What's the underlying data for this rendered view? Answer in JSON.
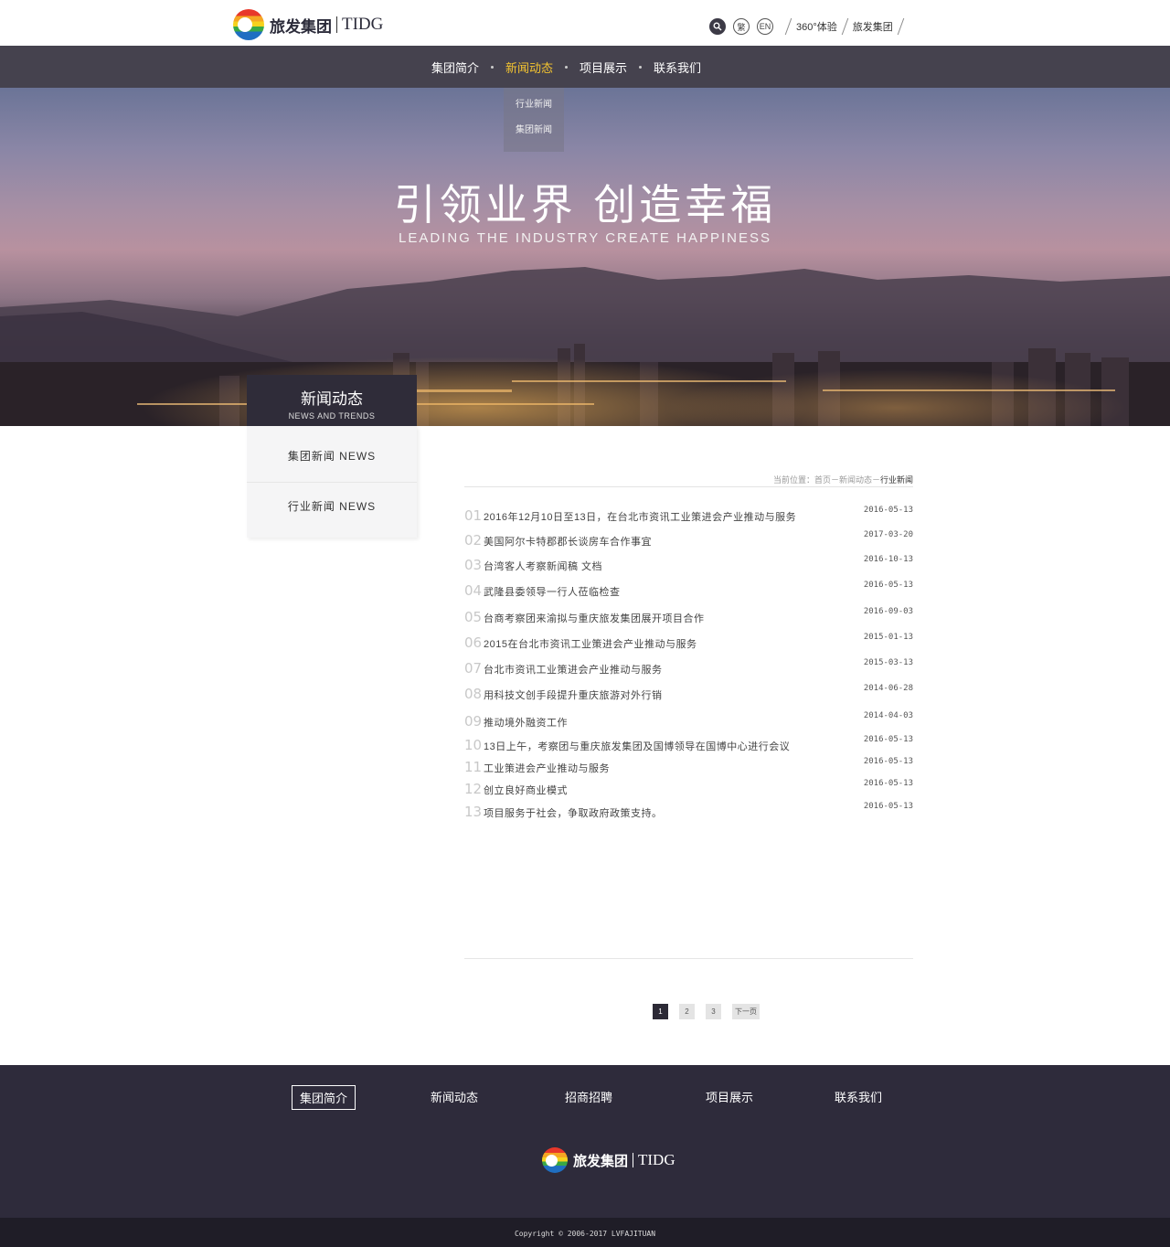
{
  "brand": {
    "name_cn": "旅发集团",
    "name_en": "TIDG"
  },
  "top_tools": {
    "trad_label": "繁",
    "en_label": "EN",
    "link_360": "360°体验",
    "link_group": "旅发集团"
  },
  "nav": {
    "items": [
      "集团简介",
      "新闻动态",
      "项目展示",
      "联系我们"
    ],
    "active_index": 1,
    "dropdown": [
      "行业新闻",
      "集团新闻"
    ]
  },
  "banner": {
    "title": "引领业界 创造幸福",
    "subtitle": "LEADING THE INDUSTRY  CREATE HAPPINESS"
  },
  "side": {
    "title_cn": "新闻动态",
    "title_en": "NEWS AND TRENDS",
    "items": [
      "集团新闻 NEWS",
      "行业新闻 NEWS"
    ]
  },
  "breadcrumb": {
    "prefix": "当前位置：首页－新闻动态－",
    "current": "行业新闻"
  },
  "news": [
    {
      "num": "01",
      "title": "2016年12月10日至13日，在台北市资讯工业策进会产业推动与服务",
      "date": "2016-05-13"
    },
    {
      "num": "02",
      "title": "美国阿尔卡特郡郡长谈房车合作事宜",
      "date": "2017-03-20"
    },
    {
      "num": "03",
      "title": "台湾客人考察新闻稿 文档",
      "date": "2016-10-13"
    },
    {
      "num": "04",
      "title": "武隆县委领导一行人莅临检查",
      "date": "2016-05-13"
    },
    {
      "num": "05",
      "title": "台商考察团来渝拟与重庆旅发集团展开项目合作",
      "date": "2016-09-03"
    },
    {
      "num": "06",
      "title": "2015在台北市资讯工业策进会产业推动与服务",
      "date": "2015-01-13"
    },
    {
      "num": "07",
      "title": "台北市资讯工业策进会产业推动与服务",
      "date": "2015-03-13"
    },
    {
      "num": "08",
      "title": "用科技文创手段提升重庆旅游对外行销",
      "date": "2014-06-28"
    },
    {
      "num": "09",
      "title": "推动境外融资工作",
      "date": "2014-04-03"
    },
    {
      "num": "10",
      "title": "13日上午，考察团与重庆旅发集团及国博领导在国博中心进行会议",
      "date": "2016-05-13"
    },
    {
      "num": "11",
      "title": "工业策进会产业推动与服务",
      "date": "2016-05-13"
    },
    {
      "num": "12",
      "title": "创立良好商业模式",
      "date": "2016-05-13"
    },
    {
      "num": "13",
      "title": "项目服务于社会，争取政府政策支持。",
      "date": "2016-05-13"
    }
  ],
  "pager": {
    "pages": [
      "1",
      "2",
      "3"
    ],
    "active": "1",
    "next": "下一页"
  },
  "footer": {
    "nav": [
      "集团简介",
      "新闻动态",
      "招商招聘",
      "项目展示",
      "联系我们"
    ],
    "copyright": "Copyright © 2006-2017 LVFAJITUAN"
  }
}
